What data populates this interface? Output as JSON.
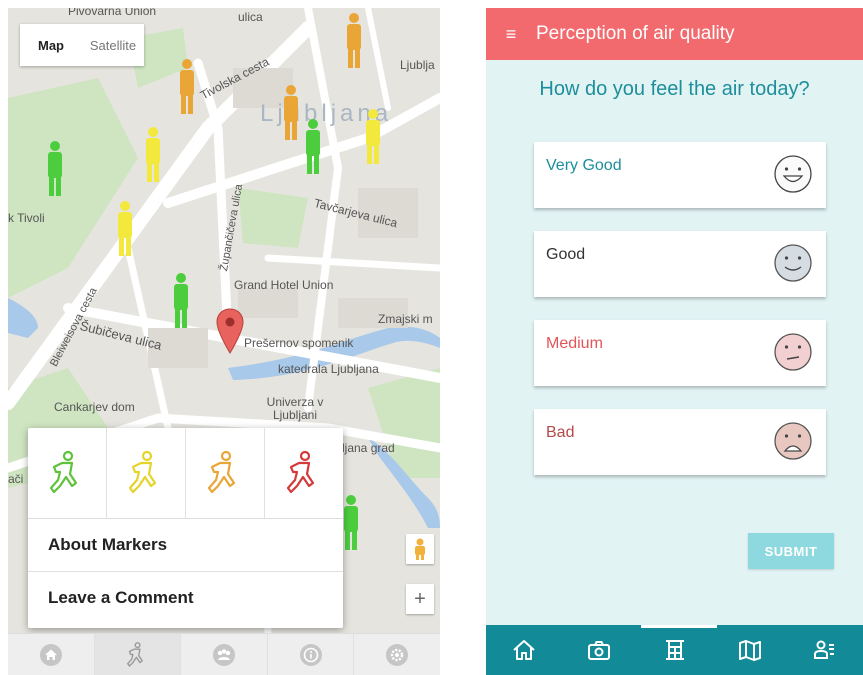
{
  "left": {
    "map_toggle": {
      "map": "Map",
      "satellite": "Satellite"
    },
    "map_labels": {
      "pivovarna": "Pivovarna Union",
      "ulica_top": "ulica",
      "tivolska": "Tivolska cesta",
      "ljublja_top": "Ljublja",
      "ljubljana": "Ljubljana",
      "tivoli": "k Tivoli",
      "tavcarjeva": "Tavčarjeva ulica",
      "zupanciceva": "Župančičeva ulica",
      "grand_hotel": "Grand Hotel Union",
      "bleiweisova": "Bleiweisova cesta",
      "subiceva": "Šubičeva ulica",
      "presernov": "Prešernov spomenik",
      "zmajski": "Zmajski m",
      "katedrala": "katedrala Ljubljana",
      "cankarjev": "Cankarjev dom",
      "univerza": "Univerza v Ljubljani",
      "ljana_grad": "ljana grad",
      "aci": "ači"
    },
    "popup": {
      "marker_colors": [
        "#5ec23a",
        "#e6d42a",
        "#e9a535",
        "#d43a3a"
      ],
      "about_markers": "About Markers",
      "leave_comment": "Leave a Comment"
    },
    "zoom_plus": "+",
    "nav_icons": [
      "home-icon",
      "walker-icon",
      "group-icon",
      "info-icon",
      "settings-icon"
    ]
  },
  "right": {
    "header": {
      "menu_icon": "≡",
      "title": "Perception of air quality",
      "color": "#f26a6e"
    },
    "question": "How do you feel the air today?",
    "options": [
      {
        "label": "Very Good",
        "color": "#1d8f9c",
        "face": "very-happy-face-icon"
      },
      {
        "label": "Good",
        "color": "#333333",
        "face": "smiling-face-icon"
      },
      {
        "label": "Medium",
        "color": "#e0555a",
        "face": "neutral-face-icon"
      },
      {
        "label": "Bad",
        "color": "#b54a4a",
        "face": "sad-face-icon"
      }
    ],
    "submit": "SUBMIT",
    "nav_icons": [
      "home-icon",
      "camera-icon",
      "building-icon",
      "map-icon",
      "people-icon"
    ],
    "nav_color": "#138a97"
  }
}
